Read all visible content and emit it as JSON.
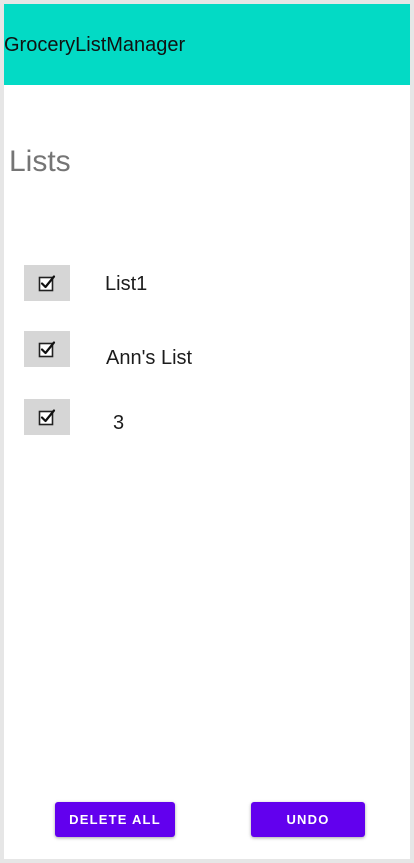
{
  "app": {
    "title": "GroceryListManager"
  },
  "section": {
    "title": "Lists"
  },
  "lists": [
    {
      "label": "List1",
      "checked": true
    },
    {
      "label": "Ann's List",
      "checked": true
    },
    {
      "label": "3",
      "checked": true
    }
  ],
  "actions": {
    "delete_all_label": "DELETE ALL",
    "undo_label": "UNDO"
  },
  "icons": {
    "checkbox": "checkbox-checked-icon"
  },
  "colors": {
    "app_bar": "#03dac5",
    "primary_button": "#6200ee",
    "checkbox_bg": "#d6d6d6",
    "section_title": "#757575"
  }
}
